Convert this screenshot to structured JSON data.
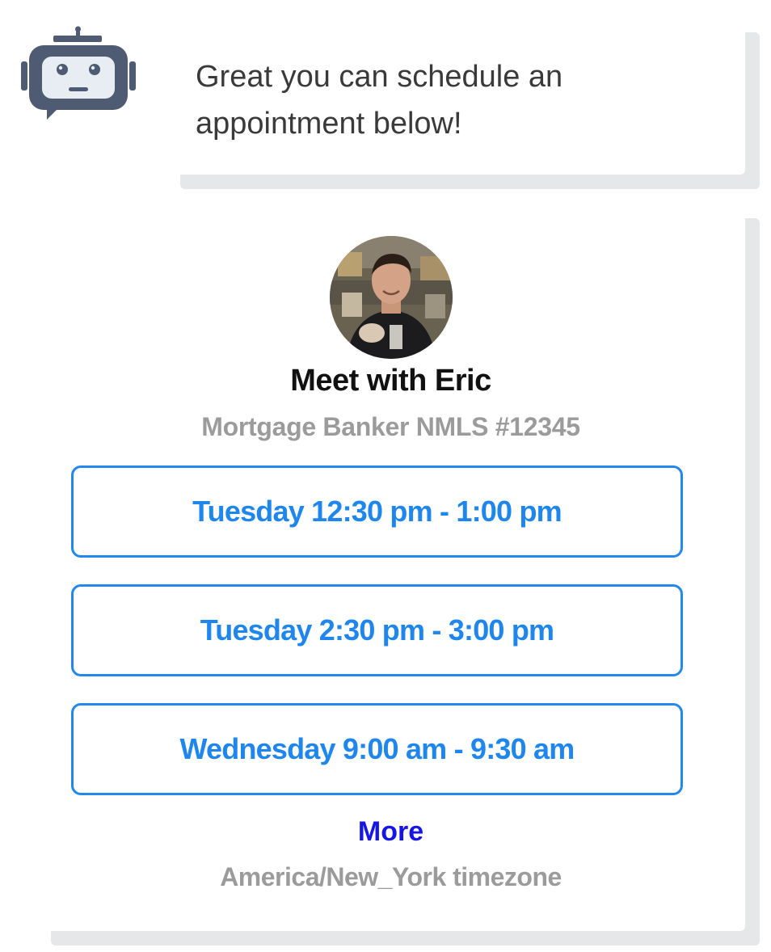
{
  "bot": {
    "icon": "robot-chat-icon",
    "color": "#4f5b72"
  },
  "message": {
    "text": "Great you can schedule an appointment below!"
  },
  "scheduler": {
    "name": "Meet with Eric",
    "subtitle": "Mortgage Banker NMLS #12345",
    "slots": [
      {
        "label": "Tuesday 12:30 pm - 1:00 pm"
      },
      {
        "label": "Tuesday 2:30 pm - 3:00 pm"
      },
      {
        "label": "Wednesday 9:00 am - 9:30 am"
      }
    ],
    "more_label": "More",
    "timezone": "America/New_York timezone"
  },
  "colors": {
    "accent": "#1e86ec",
    "link": "#1515e6",
    "muted": "#9b9b9b",
    "shadow": "#e6e7e9"
  }
}
